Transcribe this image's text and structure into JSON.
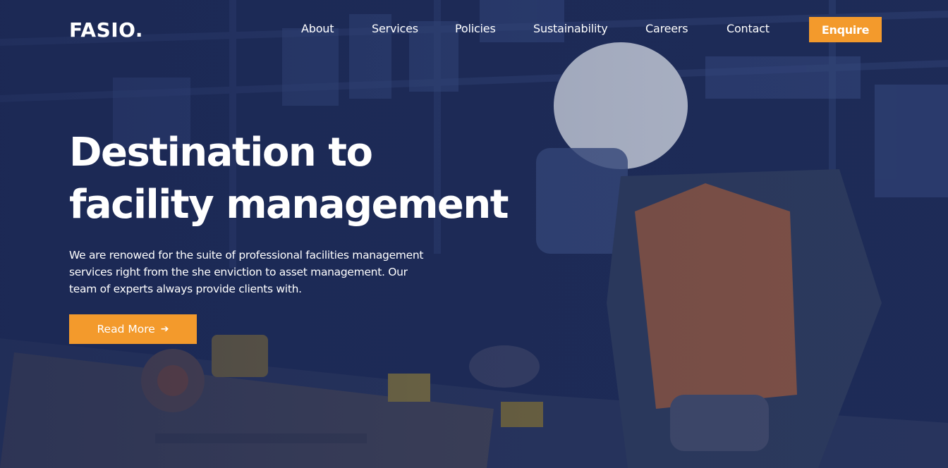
{
  "brand": {
    "logo": "FASIO."
  },
  "nav": {
    "items": [
      {
        "label": "About"
      },
      {
        "label": "Services"
      },
      {
        "label": "Policies"
      },
      {
        "label": "Sustainability"
      },
      {
        "label": "Careers"
      },
      {
        "label": "Contact"
      }
    ],
    "cta_label": "Enquire"
  },
  "hero": {
    "headline_line1": "Destination to",
    "headline_line2": "facility management",
    "description": "We are renowed for the suite of professional facilities management services right from the she enviction to asset management. Our team of experts always provide clients with.",
    "button_label": "Read More",
    "button_icon": "arrow-right-icon"
  },
  "colors": {
    "accent": "#f39a2c",
    "overlay": "#1c2a55",
    "text": "#ffffff"
  }
}
